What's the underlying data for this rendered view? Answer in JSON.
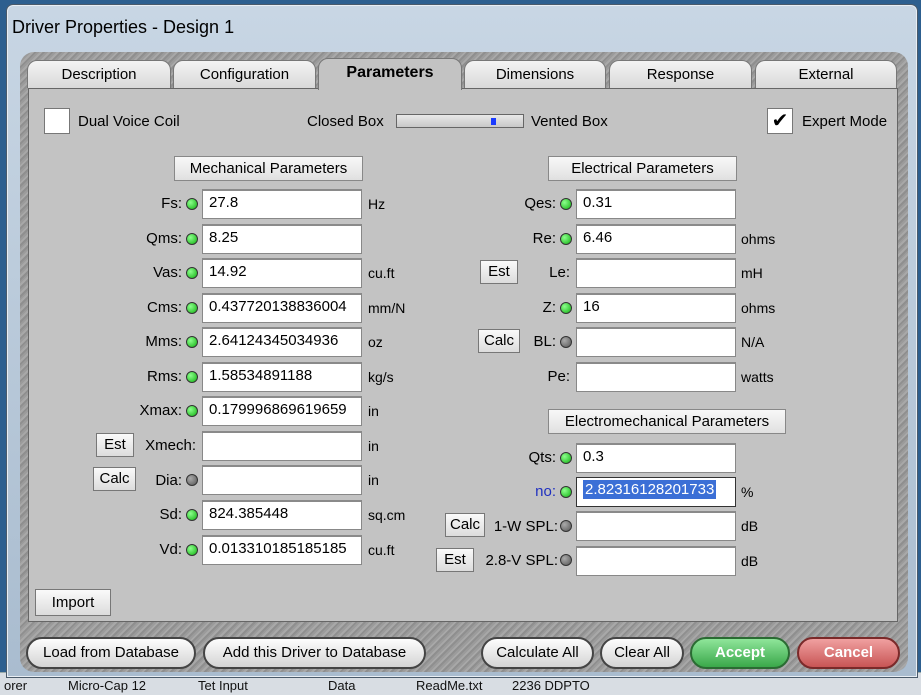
{
  "window": {
    "title": "Driver Properties - Design 1"
  },
  "tabs": [
    "Description",
    "Configuration",
    "Parameters",
    "Dimensions",
    "Response",
    "External"
  ],
  "options": {
    "dual_voice_coil": "Dual Voice Coil",
    "closed_box": "Closed Box",
    "vented_box": "Vented Box",
    "expert_mode": "Expert Mode",
    "expert_checked": "✔"
  },
  "mechanical": {
    "header": "Mechanical Parameters",
    "fs": {
      "label": "Fs:",
      "value": "27.8",
      "unit": "Hz"
    },
    "qms": {
      "label": "Qms:",
      "value": "8.25",
      "unit": ""
    },
    "vas": {
      "label": "Vas:",
      "value": "14.92",
      "unit": "cu.ft"
    },
    "cms": {
      "label": "Cms:",
      "value": "0.437720138836004",
      "unit": "mm/N"
    },
    "mms": {
      "label": "Mms:",
      "value": "2.64124345034936",
      "unit": "oz"
    },
    "rms": {
      "label": "Rms:",
      "value": "1.58534891188",
      "unit": "kg/s"
    },
    "xmax": {
      "label": "Xmax:",
      "value": "0.179996869619659",
      "unit": "in"
    },
    "xmech": {
      "label": "Xmech:",
      "value": "",
      "unit": "in",
      "button": "Est"
    },
    "dia": {
      "label": "Dia:",
      "value": "",
      "unit": "in",
      "button": "Calc"
    },
    "sd": {
      "label": "Sd:",
      "value": "824.385448",
      "unit": "sq.cm"
    },
    "vd": {
      "label": "Vd:",
      "value": "0.0133101851851​85",
      "unit": "cu.ft"
    }
  },
  "electrical": {
    "header": "Electrical Parameters",
    "qes": {
      "label": "Qes:",
      "value": "0.31",
      "unit": ""
    },
    "re": {
      "label": "Re:",
      "value": "6.46",
      "unit": "ohms"
    },
    "le": {
      "label": "Le:",
      "value": "",
      "unit": "mH",
      "button": "Est"
    },
    "z": {
      "label": "Z:",
      "value": "16",
      "unit": "ohms"
    },
    "bl": {
      "label": "BL:",
      "value": "",
      "unit": "N/A",
      "button": "Calc"
    },
    "pe": {
      "label": "Pe:",
      "value": "",
      "unit": "watts"
    }
  },
  "electromechanical": {
    "header": "Electromechanical Parameters",
    "qts": {
      "label": "Qts:",
      "value": "0.3",
      "unit": ""
    },
    "no": {
      "label": "no:",
      "value": "2.82316128201733",
      "unit": "%"
    },
    "spl1w": {
      "label": "1-W SPL:",
      "value": "",
      "unit": "dB",
      "button": "Calc"
    },
    "spl28v": {
      "label": "2.8-V SPL:",
      "value": "",
      "unit": "dB",
      "button": "Est"
    }
  },
  "buttons": {
    "import": "Import",
    "load_db": "Load from Database",
    "add_db": "Add this Driver to Database",
    "calc_all": "Calculate All",
    "clear_all": "Clear All",
    "accept": "Accept",
    "cancel": "Cancel"
  },
  "taskbar": [
    "orer",
    "Micro-Cap 12",
    "Tet Input",
    "Data",
    "ReadMe.txt",
    "2236 DDPTO"
  ]
}
